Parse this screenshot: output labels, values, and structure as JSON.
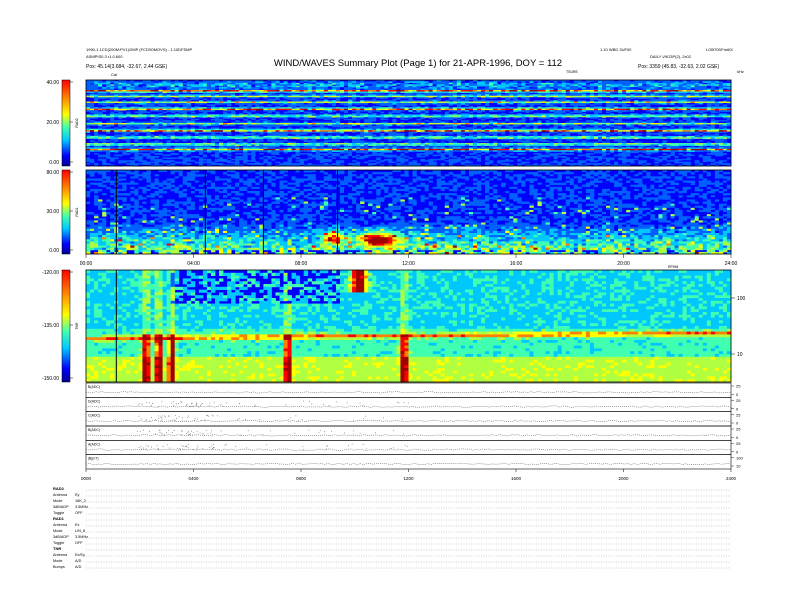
{
  "header": {
    "left_line1": "1990-1 1CD(200M:PV1)/2MP (FCDS0MOVS) - 1.10DFSMP",
    "left_line2": "ASMPIS0.3 r1.0.600",
    "pos_left": "Pos:   45.14(3.684, -32.67, 2.44 GSE)",
    "title": "WIND/WAVES Summary Plot (Page 1) for 21-APR-1996, DOY = 112",
    "right_line1": "1.10 WBD 3UF00",
    "right_line1b": "LOB70DFm60l",
    "right_line2": "DAILY V9G3P(2), 2x02",
    "pos_right": "Pos:   3359 (45.83, -32.63, 2.02 GSE)",
    "tb_marker": "TSURE",
    "cal_marker": "Cal",
    "mhz_label": "kHz"
  },
  "chart_data": [
    {
      "type": "heatmap",
      "name": "RAD2",
      "ylabel": "RAD2",
      "colorbar_ticks": [
        "40.00",
        "20.00",
        "0.00"
      ],
      "ylim": [
        0,
        40
      ]
    },
    {
      "type": "heatmap",
      "name": "RAD1",
      "ylabel": "RAD1",
      "colorbar_ticks": [
        "80.00",
        "30.00",
        "0.00"
      ],
      "ylim": [
        0,
        80
      ],
      "xticks": [
        "00:00",
        "04:00",
        "08:00",
        "12:00",
        "16:00",
        "20:00",
        "24:00"
      ],
      "x_corner_label": "RPHM"
    },
    {
      "type": "heatmap",
      "name": "TNR",
      "ylabel": "TNR",
      "colorbar_ticks": [
        "-120.00",
        "-135.00",
        "-150.00"
      ],
      "right_ticks": [
        "100",
        "10"
      ],
      "ylim": [
        -150,
        -120
      ]
    },
    {
      "type": "line",
      "name": "stacked time series",
      "panels": [
        {
          "label": "B(ADC)",
          "right_ticks": [
            "25",
            "0"
          ]
        },
        {
          "label": "D(ADC)",
          "right_ticks": [
            "25",
            "0"
          ]
        },
        {
          "label": "C(ADC)",
          "right_ticks": [
            "25",
            "0"
          ]
        },
        {
          "label": "B(ADC)",
          "right_ticks": [
            "25",
            "0"
          ]
        },
        {
          "label": "A(ADC)",
          "right_ticks": [
            "25",
            "0"
          ]
        },
        {
          "label": "|B|(nT)",
          "right_ticks": [
            "100",
            "10"
          ]
        }
      ],
      "xticks": [
        "0000",
        "0400",
        "0800",
        "1200",
        "1600",
        "2000",
        "2400"
      ]
    }
  ],
  "footer": {
    "sections": [
      {
        "title": "RAD2",
        "rows": [
          [
            "Antenna",
            "Ey"
          ],
          [
            "Mode",
            "16K_2"
          ],
          [
            "3dB/ADP",
            "3.5MHz"
          ],
          [
            "Toggle",
            "OFF"
          ]
        ]
      },
      {
        "title": "RAD1",
        "rows": [
          [
            "Antenna",
            "Ex"
          ],
          [
            "Mode",
            "LIN_8"
          ],
          [
            "3dB/ADP",
            "3.5MHz"
          ],
          [
            "Toggle",
            "OFF"
          ]
        ]
      },
      {
        "title": "TNR",
        "rows": [
          [
            "Antenna",
            "Ex/Ey"
          ],
          [
            "Mode",
            "A/D"
          ],
          [
            "Bumps",
            "A/D"
          ]
        ]
      }
    ]
  },
  "colors": {
    "cmap": [
      "#00008f",
      "#0000ff",
      "#0060ff",
      "#00c8ff",
      "#40ffb0",
      "#b0ff40",
      "#ffff00",
      "#ff8000",
      "#ff0000",
      "#a00000"
    ],
    "axis": "#000000",
    "dots": "#888888"
  }
}
